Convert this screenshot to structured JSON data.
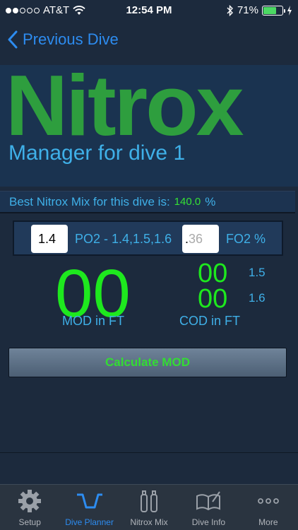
{
  "status_bar": {
    "carrier": "AT&T",
    "time": "12:54 PM",
    "battery": "71%",
    "battery_level": 0.71
  },
  "nav": {
    "back_label": "Previous Dive"
  },
  "header": {
    "title": "Nitrox",
    "subtitle": "Manager for dive 1"
  },
  "best_mix": {
    "label": "Best Nitrox Mix for this dive is:",
    "value": "140.0",
    "unit": "%"
  },
  "inputs": {
    "po2_value": "1.4",
    "po2_label": "PO2 - 1.4,1.5,1.6",
    "fo2_value": ".",
    "fo2_placeholder": "36",
    "fo2_label": "FO2 %"
  },
  "results": {
    "mod_value": "00",
    "mod_label": "MOD in FT",
    "cod_15_value": "00",
    "cod_15_label": "1.5",
    "cod_16_value": "00",
    "cod_16_label": "1.6",
    "cod_label": "COD in FT"
  },
  "calculate_button": "Calculate MOD",
  "tabs": [
    {
      "label": "Setup",
      "icon": "gear-icon",
      "active": false
    },
    {
      "label": "Dive Planner",
      "icon": "dive-profile-icon",
      "active": true
    },
    {
      "label": "Nitrox Mix",
      "icon": "tanks-icon",
      "active": false
    },
    {
      "label": "Dive Info",
      "icon": "logbook-icon",
      "active": false
    },
    {
      "label": "More",
      "icon": "more-icon",
      "active": false
    }
  ],
  "colors": {
    "background": "#1c2a3d",
    "title_green": "#2e9e3e",
    "value_green": "#1ee81e",
    "label_blue": "#3fb0e8",
    "active_tab": "#2d8cf0"
  }
}
